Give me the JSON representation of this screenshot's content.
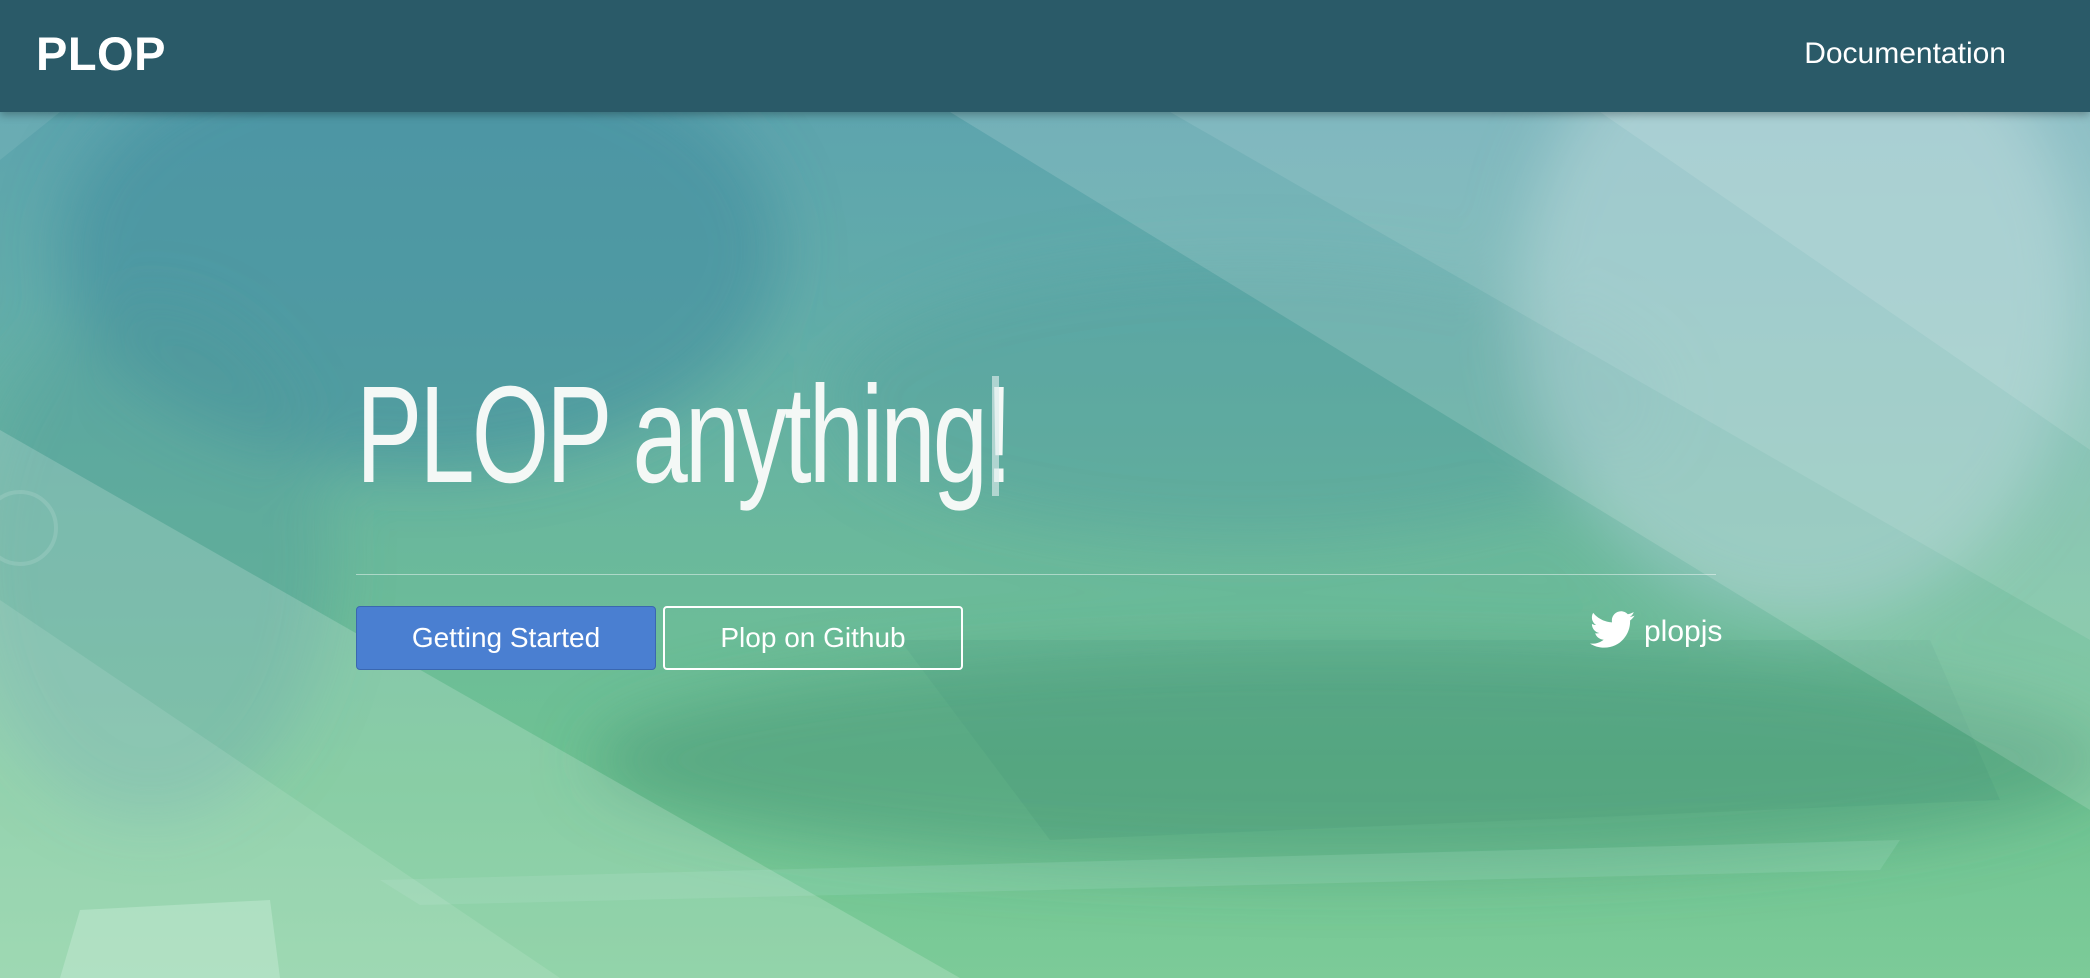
{
  "navbar": {
    "brand": "PLOP",
    "documentation_link": "Documentation"
  },
  "hero": {
    "title": "PLOP anything!",
    "primary_button": "Getting Started",
    "secondary_button": "Plop on Github",
    "twitter_handle": "plopjs"
  },
  "icons": {
    "twitter": "twitter-bird-icon"
  },
  "colors": {
    "navbar_bg": "#2a5a68",
    "primary_button": "#4a7fd1",
    "hero_gradient_top": "#5a9fb0",
    "hero_gradient_bottom": "#7ccb98"
  }
}
